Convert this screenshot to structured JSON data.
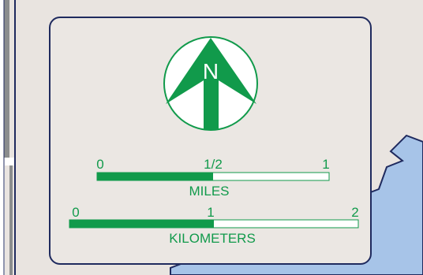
{
  "colors": {
    "background": "#e9e4e0",
    "water": "#a7c4e8",
    "outline": "#1f2a5e",
    "accent_green": "#119a4b",
    "panel": "#ebe7e3"
  },
  "north_arrow": {
    "letter": "N",
    "icon": "north-arrow-icon"
  },
  "scale_bars": {
    "miles": {
      "unit_label": "MILES",
      "tick_labels": [
        "0",
        "1/2",
        "1"
      ],
      "ticks": [
        0,
        0.5,
        1
      ],
      "filled_fraction": 0.5
    },
    "kilometers": {
      "unit_label": "KILOMETERS",
      "tick_labels": [
        "0",
        "1",
        "2"
      ],
      "ticks": [
        0,
        1,
        2
      ],
      "filled_fraction": 0.5
    }
  }
}
